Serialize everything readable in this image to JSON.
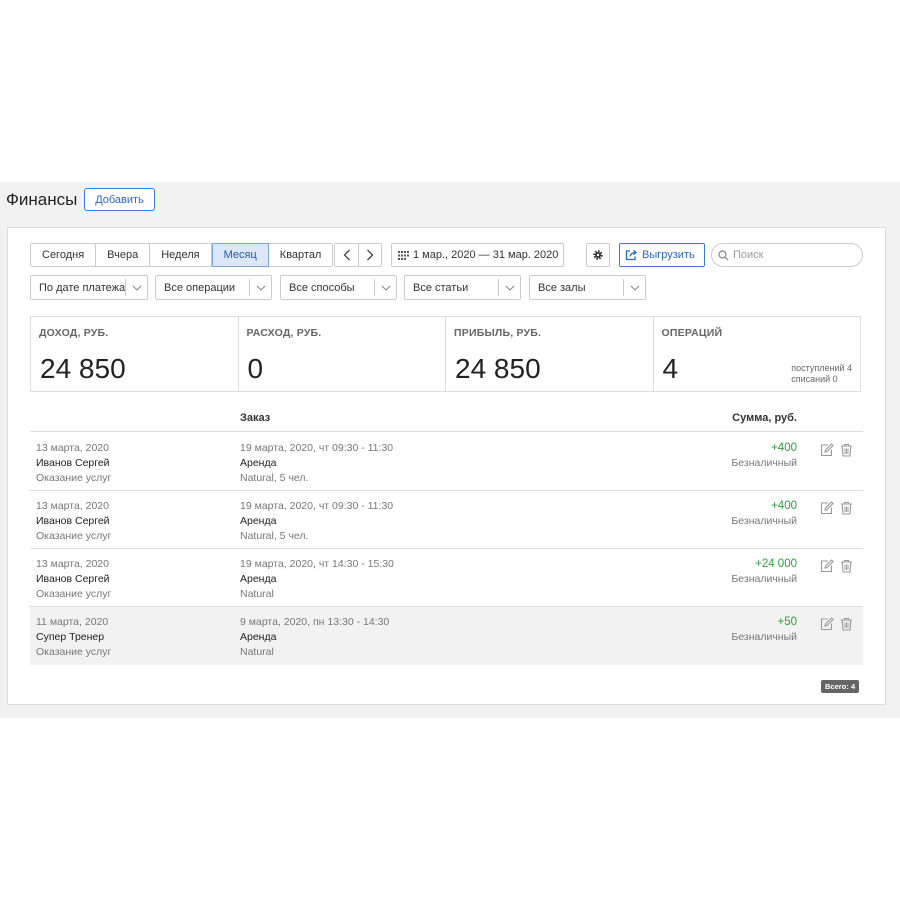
{
  "header": {
    "title": "Финансы",
    "add_label": "Добавить"
  },
  "toolbar": {
    "periods": [
      {
        "label": "Сегодня",
        "active": false
      },
      {
        "label": "Вчера",
        "active": false
      },
      {
        "label": "Неделя",
        "active": false
      },
      {
        "label": "Месяц",
        "active": true
      },
      {
        "label": "Квартал",
        "active": false
      }
    ],
    "date_range": "1 мар., 2020 — 31 мар. 2020",
    "export_label": "Выгрузить",
    "search_placeholder": "Поиск"
  },
  "filters": [
    {
      "label": "По дате платежа"
    },
    {
      "label": "Все операции"
    },
    {
      "label": "Все способы"
    },
    {
      "label": "Все статьи"
    },
    {
      "label": "Все залы"
    }
  ],
  "stats": [
    {
      "label": "ДОХОД, РУБ.",
      "value": "24 850"
    },
    {
      "label": "РАСХОД, РУБ.",
      "value": "0"
    },
    {
      "label": "ПРИБЫЛЬ, РУБ.",
      "value": "24 850"
    },
    {
      "label": "ОПЕРАЦИЙ",
      "value": "4",
      "sub1": "поступлений 4",
      "sub2": "списаний 0"
    }
  ],
  "table": {
    "headers": {
      "order": "Заказ",
      "sum": "Сумма, руб."
    },
    "rows": [
      {
        "date": "13 марта, 2020",
        "person": "Иванов Сергей",
        "category": "Оказание услуг",
        "order_time": "19 марта, 2020, чт 09:30 - 11:30",
        "order_type": "Аренда",
        "order_detail": "Natural, 5 чел.",
        "amount": "+400",
        "method": "Безналичный"
      },
      {
        "date": "13 марта, 2020",
        "person": "Иванов Сергей",
        "category": "Оказание услуг",
        "order_time": "19 марта, 2020, чт 09:30 - 11:30",
        "order_type": "Аренда",
        "order_detail": "Natural, 5 чел.",
        "amount": "+400",
        "method": "Безналичный"
      },
      {
        "date": "13 марта, 2020",
        "person": "Иванов Сергей",
        "category": "Оказание услуг",
        "order_time": "19 марта, 2020, чт 14:30 - 15:30",
        "order_type": "Аренда",
        "order_detail": "Natural",
        "amount": "+24 000",
        "method": "Безналичный"
      },
      {
        "date": "11 марта, 2020",
        "person": "Супер Тренер",
        "category": "Оказание услуг",
        "order_time": "9 марта, 2020, пн 13:30 - 14:30",
        "order_type": "Аренда",
        "order_detail": "Natural",
        "amount": "+50",
        "method": "Безналичный"
      }
    ]
  },
  "footer": {
    "total_label": "Всего: 4"
  },
  "colors": {
    "accent": "#2b67c2",
    "positive": "#2e9d3e",
    "active_bg": "#dce8f7"
  }
}
